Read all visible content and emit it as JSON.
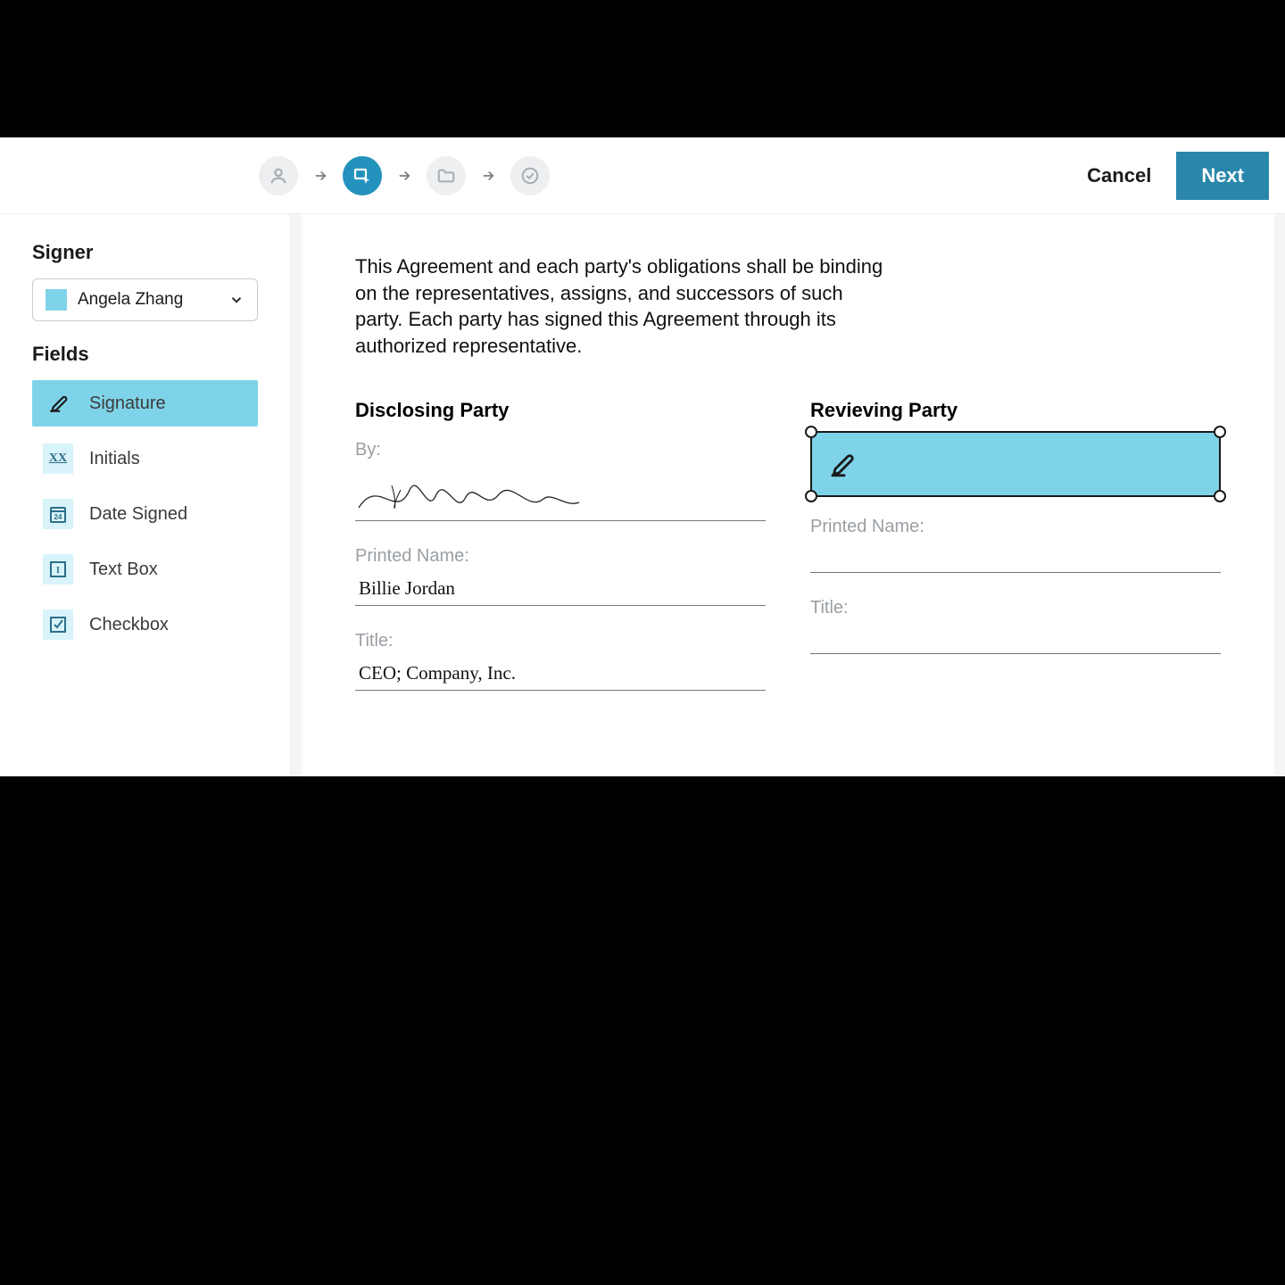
{
  "header": {
    "cancel_label": "Cancel",
    "next_label": "Next",
    "steps": [
      "person",
      "fields",
      "folder",
      "complete"
    ],
    "active_step_index": 1
  },
  "sidebar": {
    "signer_heading": "Signer",
    "signer_selected": "Angela Zhang",
    "signer_color": "#7fd3e8",
    "fields_heading": "Fields",
    "fields": [
      {
        "id": "signature",
        "label": "Signature",
        "selected": true
      },
      {
        "id": "initials",
        "label": "Initials",
        "selected": false
      },
      {
        "id": "date-signed",
        "label": "Date Signed",
        "selected": false
      },
      {
        "id": "text-box",
        "label": "Text Box",
        "selected": false
      },
      {
        "id": "checkbox",
        "label": "Checkbox",
        "selected": false
      }
    ]
  },
  "document": {
    "agreement_text": "This Agreement and each party's obligations shall be binding on the representatives, assigns, and successors of such party. Each party has signed this Agreement through its authorized representative.",
    "disclosing": {
      "heading": "Disclosing Party",
      "by_label": "By:",
      "printed_name_label": "Printed Name:",
      "printed_name_value": "Billie Jordan",
      "title_label": "Title:",
      "title_value": "CEO; Company, Inc."
    },
    "reviewing": {
      "heading": "Revieving Party",
      "printed_name_label": "Printed Name:",
      "title_label": "Title:"
    }
  }
}
